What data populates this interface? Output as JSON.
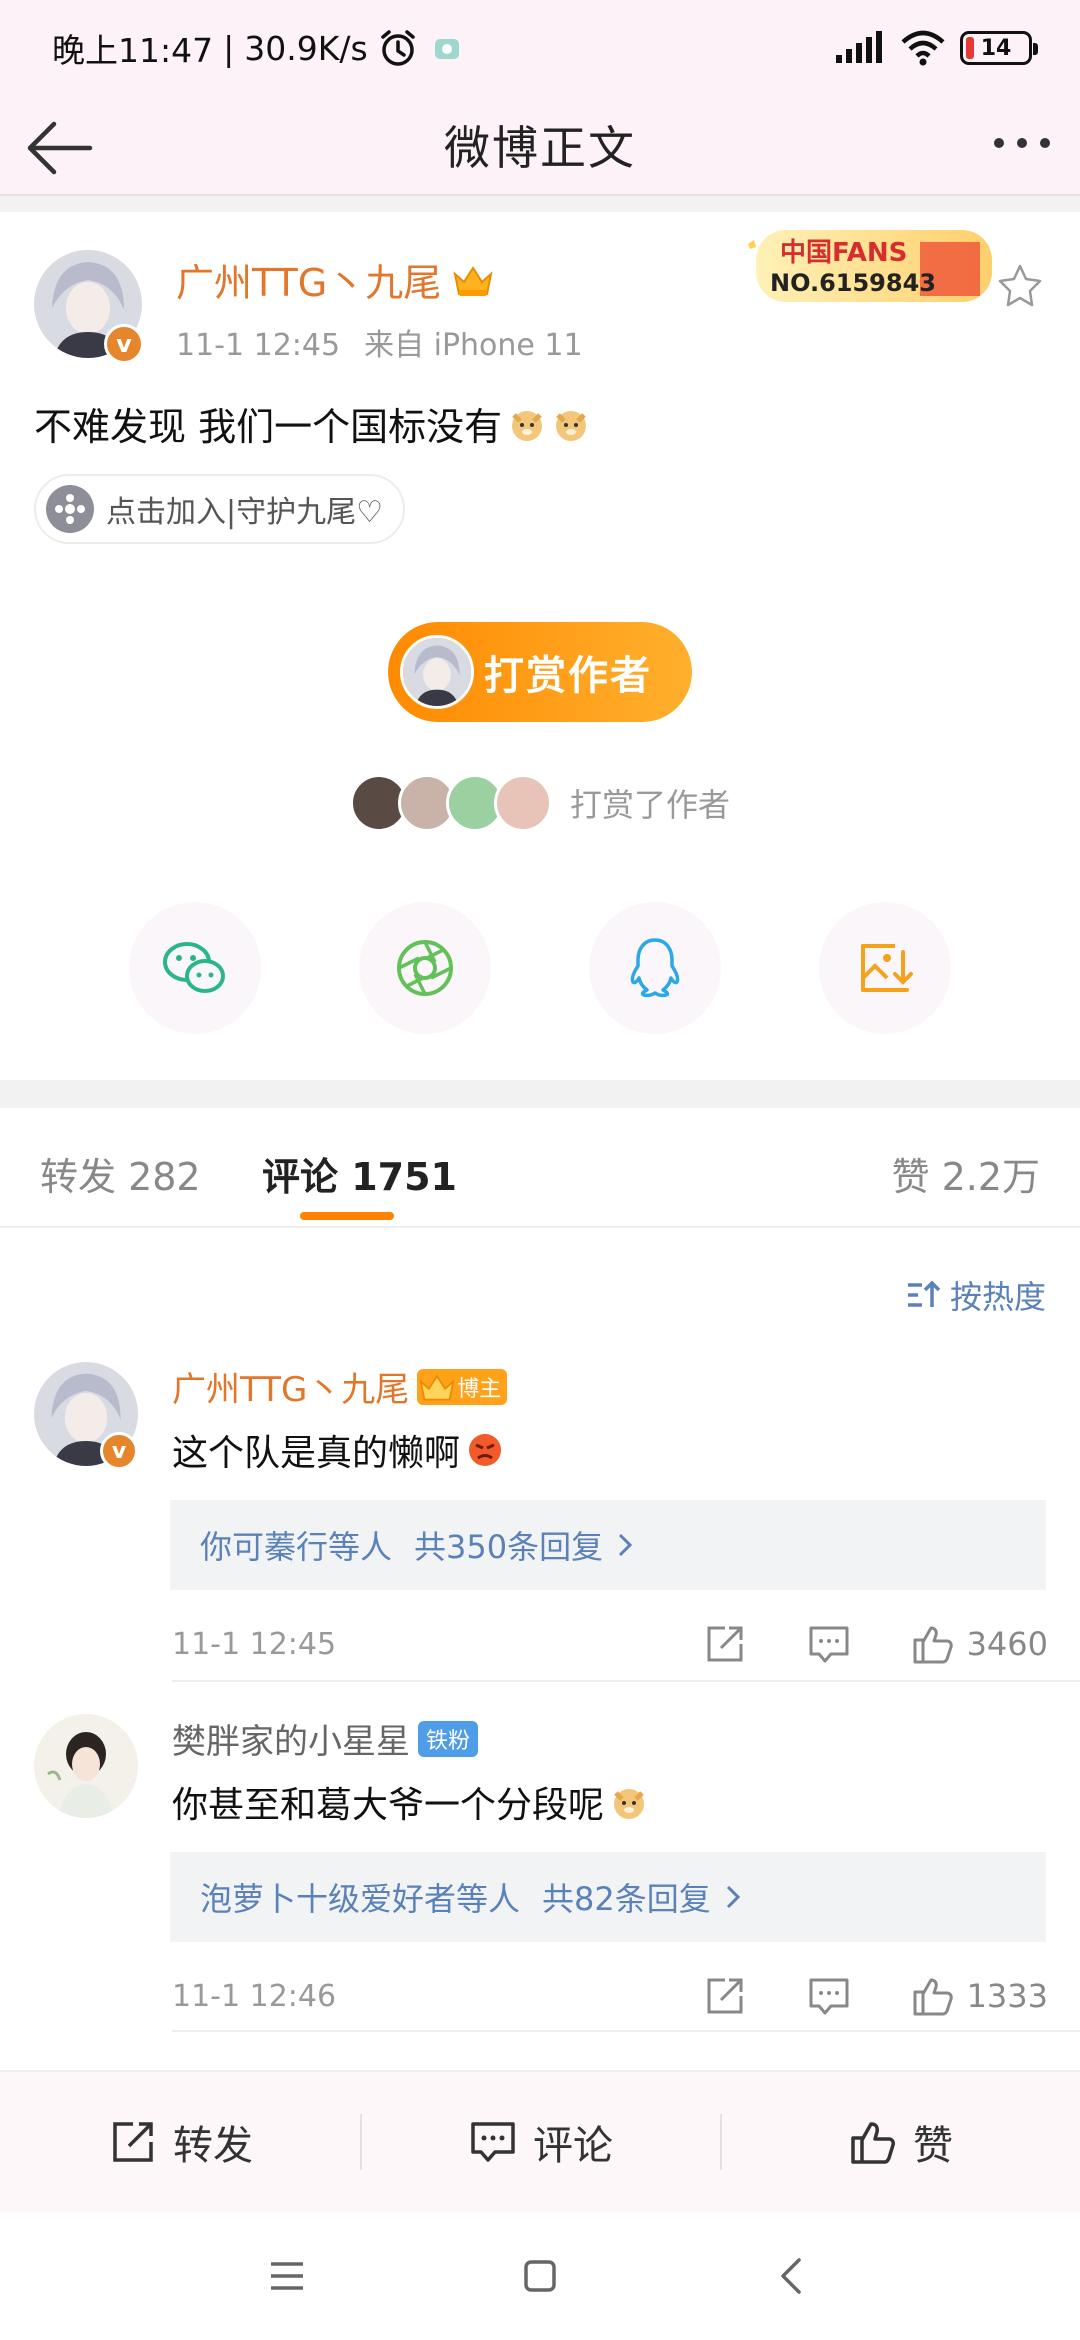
{
  "status_bar": {
    "time": "晚上11:47",
    "net_speed": "30.9K/s",
    "battery": "14"
  },
  "nav": {
    "title": "微博正文"
  },
  "post": {
    "author": "广州TTG丶九尾",
    "timestamp": "11-1 12:45",
    "source": "来自 iPhone 11",
    "fans_badge": {
      "label": "中国FANS",
      "number": "NO.6159843"
    },
    "text": "不难发现 我们一个国标没有",
    "topic_pill": "点击加入|守护九尾♡",
    "tip_button": "打赏作者",
    "tippers_text": "打赏了作者",
    "share_targets": [
      "wechat-icon",
      "moments-icon",
      "qq-icon",
      "save-image-icon"
    ]
  },
  "tabs": {
    "repost": "转发 282",
    "comments": "评论 1751",
    "likes": "赞 2.2万"
  },
  "sort_label": "按热度",
  "comments": [
    {
      "name": "广州TTG丶九尾",
      "badge": "博主",
      "text": "这个队是真的懒啊",
      "reply_who": "你可蓁行等人",
      "reply_count": "共350条回复",
      "time": "11-1 12:45",
      "likes": "3460"
    },
    {
      "name": "樊胖家的小星星",
      "badge": "铁粉",
      "text": "你甚至和葛大爷一个分段呢",
      "reply_who": "泡萝卜十级爱好者等人",
      "reply_count": "共82条回复",
      "time": "11-1 12:46",
      "likes": "1333"
    }
  ],
  "toolbar": {
    "repost": "转发",
    "comment": "评论",
    "like": "赞"
  },
  "colors": {
    "brand_orange": "#ff8200",
    "name_orange": "#e2762a",
    "link_blue": "#5a82b8",
    "page_tint": "#fdf2f7"
  }
}
